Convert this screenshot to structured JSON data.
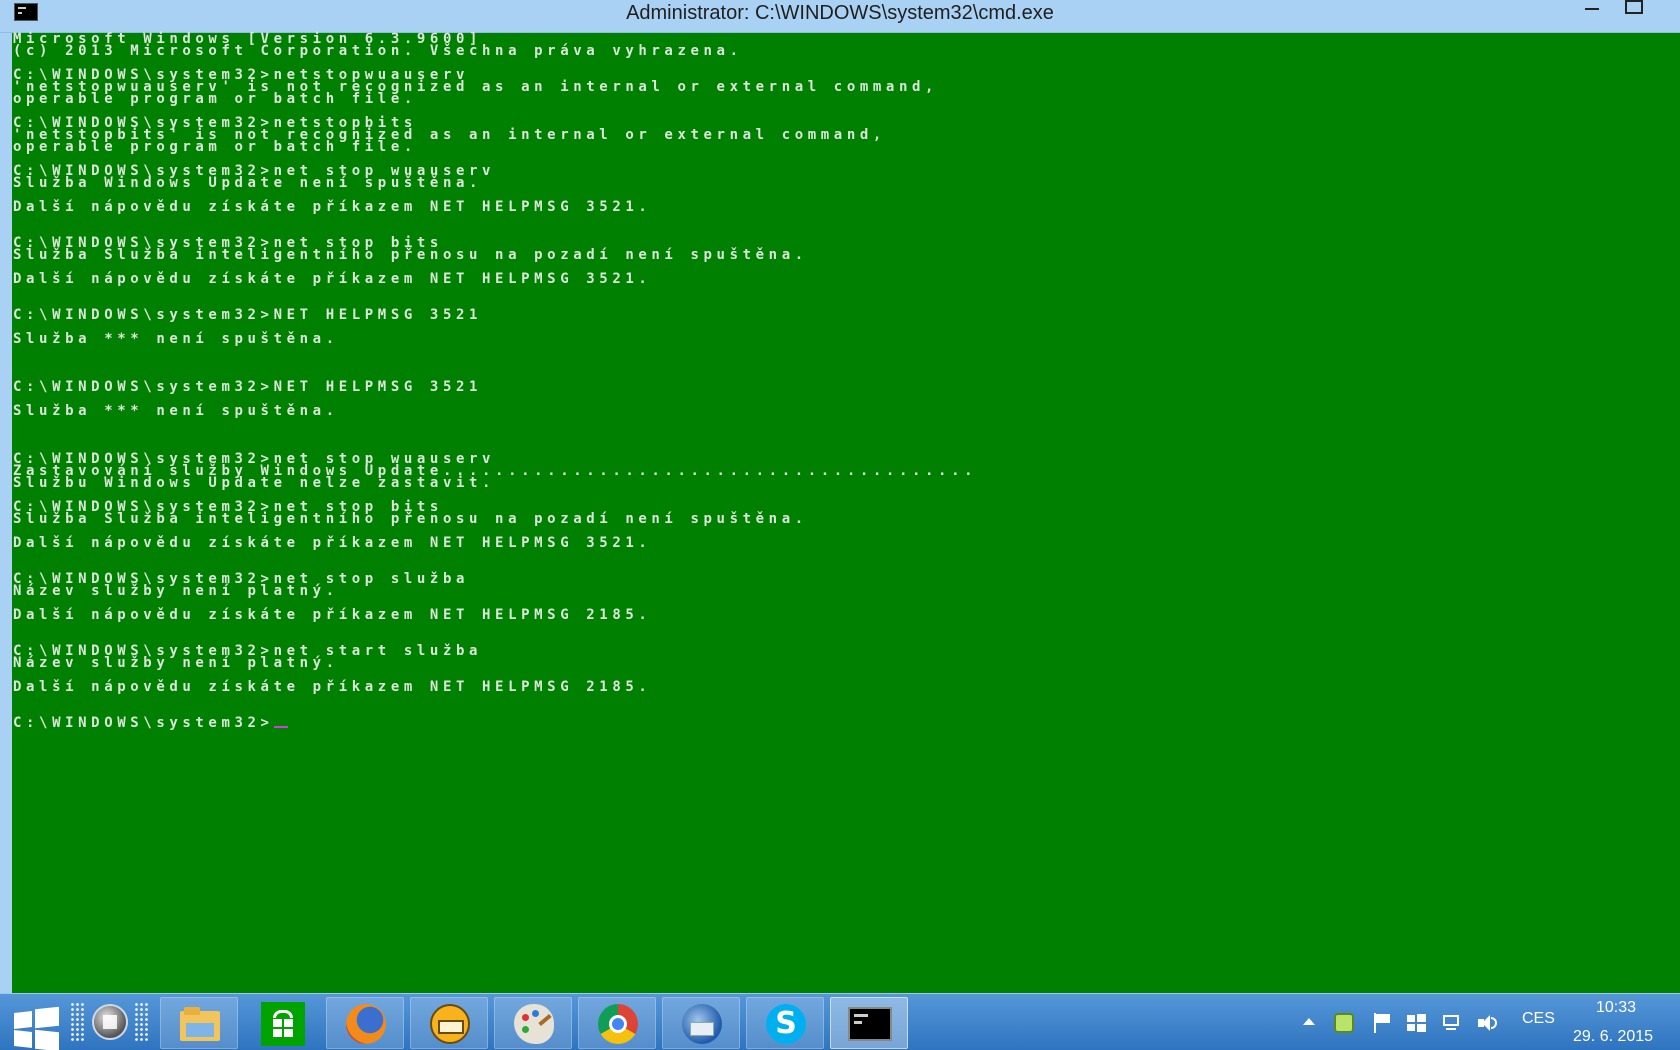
{
  "window": {
    "title": "Administrator: C:\\WINDOWS\\system32\\cmd.exe"
  },
  "console": {
    "lines": [
      "Microsoft Windows [Version 6.3.9600]",
      "(c) 2013 Microsoft Corporation. Všechna práva vyhrazena.",
      "",
      "C:\\WINDOWS\\system32>netstopwuauserv",
      "'netstopwuauserv' is not recognized as an internal or external command,",
      "operable program or batch file.",
      "",
      "C:\\WINDOWS\\system32>netstopbits",
      "'netstopbits' is not recognized as an internal or external command,",
      "operable program or batch file.",
      "",
      "C:\\WINDOWS\\system32>net stop wuauserv",
      "Služba Windows Update není spuštěna.",
      "",
      "Další nápovědu získáte příkazem NET HELPMSG 3521.",
      "",
      "",
      "C:\\WINDOWS\\system32>net stop bits",
      "Služba Služba inteligentního přenosu na pozadí není spuštěna.",
      "",
      "Další nápovědu získáte příkazem NET HELPMSG 3521.",
      "",
      "",
      "C:\\WINDOWS\\system32>NET HELPMSG 3521",
      "",
      "Služba *** není spuštěna.",
      "",
      "",
      "",
      "C:\\WINDOWS\\system32>NET HELPMSG 3521",
      "",
      "Služba *** není spuštěna.",
      "",
      "",
      "",
      "C:\\WINDOWS\\system32>net stop wuauserv",
      "Zastavování služby Windows Update.........................................",
      "Službu Windows Update nelze zastavit.",
      "",
      "C:\\WINDOWS\\system32>net stop bits",
      "Služba Služba inteligentního přenosu na pozadí není spuštěna.",
      "",
      "Další nápovědu získáte příkazem NET HELPMSG 3521.",
      "",
      "",
      "C:\\WINDOWS\\system32>net stop služba",
      "Název služby není platný.",
      "",
      "Další nápovědu získáte příkazem NET HELPMSG 2185.",
      "",
      "",
      "C:\\WINDOWS\\system32>net start služba",
      "Název služby není platný.",
      "",
      "Další nápovědu získáte příkazem NET HELPMSG 2185.",
      "",
      ""
    ],
    "prompt": "C:\\WINDOWS\\system32>"
  },
  "taskbar": {
    "apps": [
      {
        "name": "file-explorer"
      },
      {
        "name": "store"
      },
      {
        "name": "firefox"
      },
      {
        "name": "mail-client"
      },
      {
        "name": "paint"
      },
      {
        "name": "chrome"
      },
      {
        "name": "thunderbird"
      },
      {
        "name": "skype"
      },
      {
        "name": "command-prompt"
      }
    ],
    "tray": {
      "language": "CES",
      "time": "10:33",
      "date": "29. 6. 2015"
    }
  },
  "colors": {
    "console_bg": "#008000",
    "console_text": "#d9e6d9",
    "titlebar_bg": "#a9d1f3",
    "taskbar_bg": "#3a80c8"
  }
}
